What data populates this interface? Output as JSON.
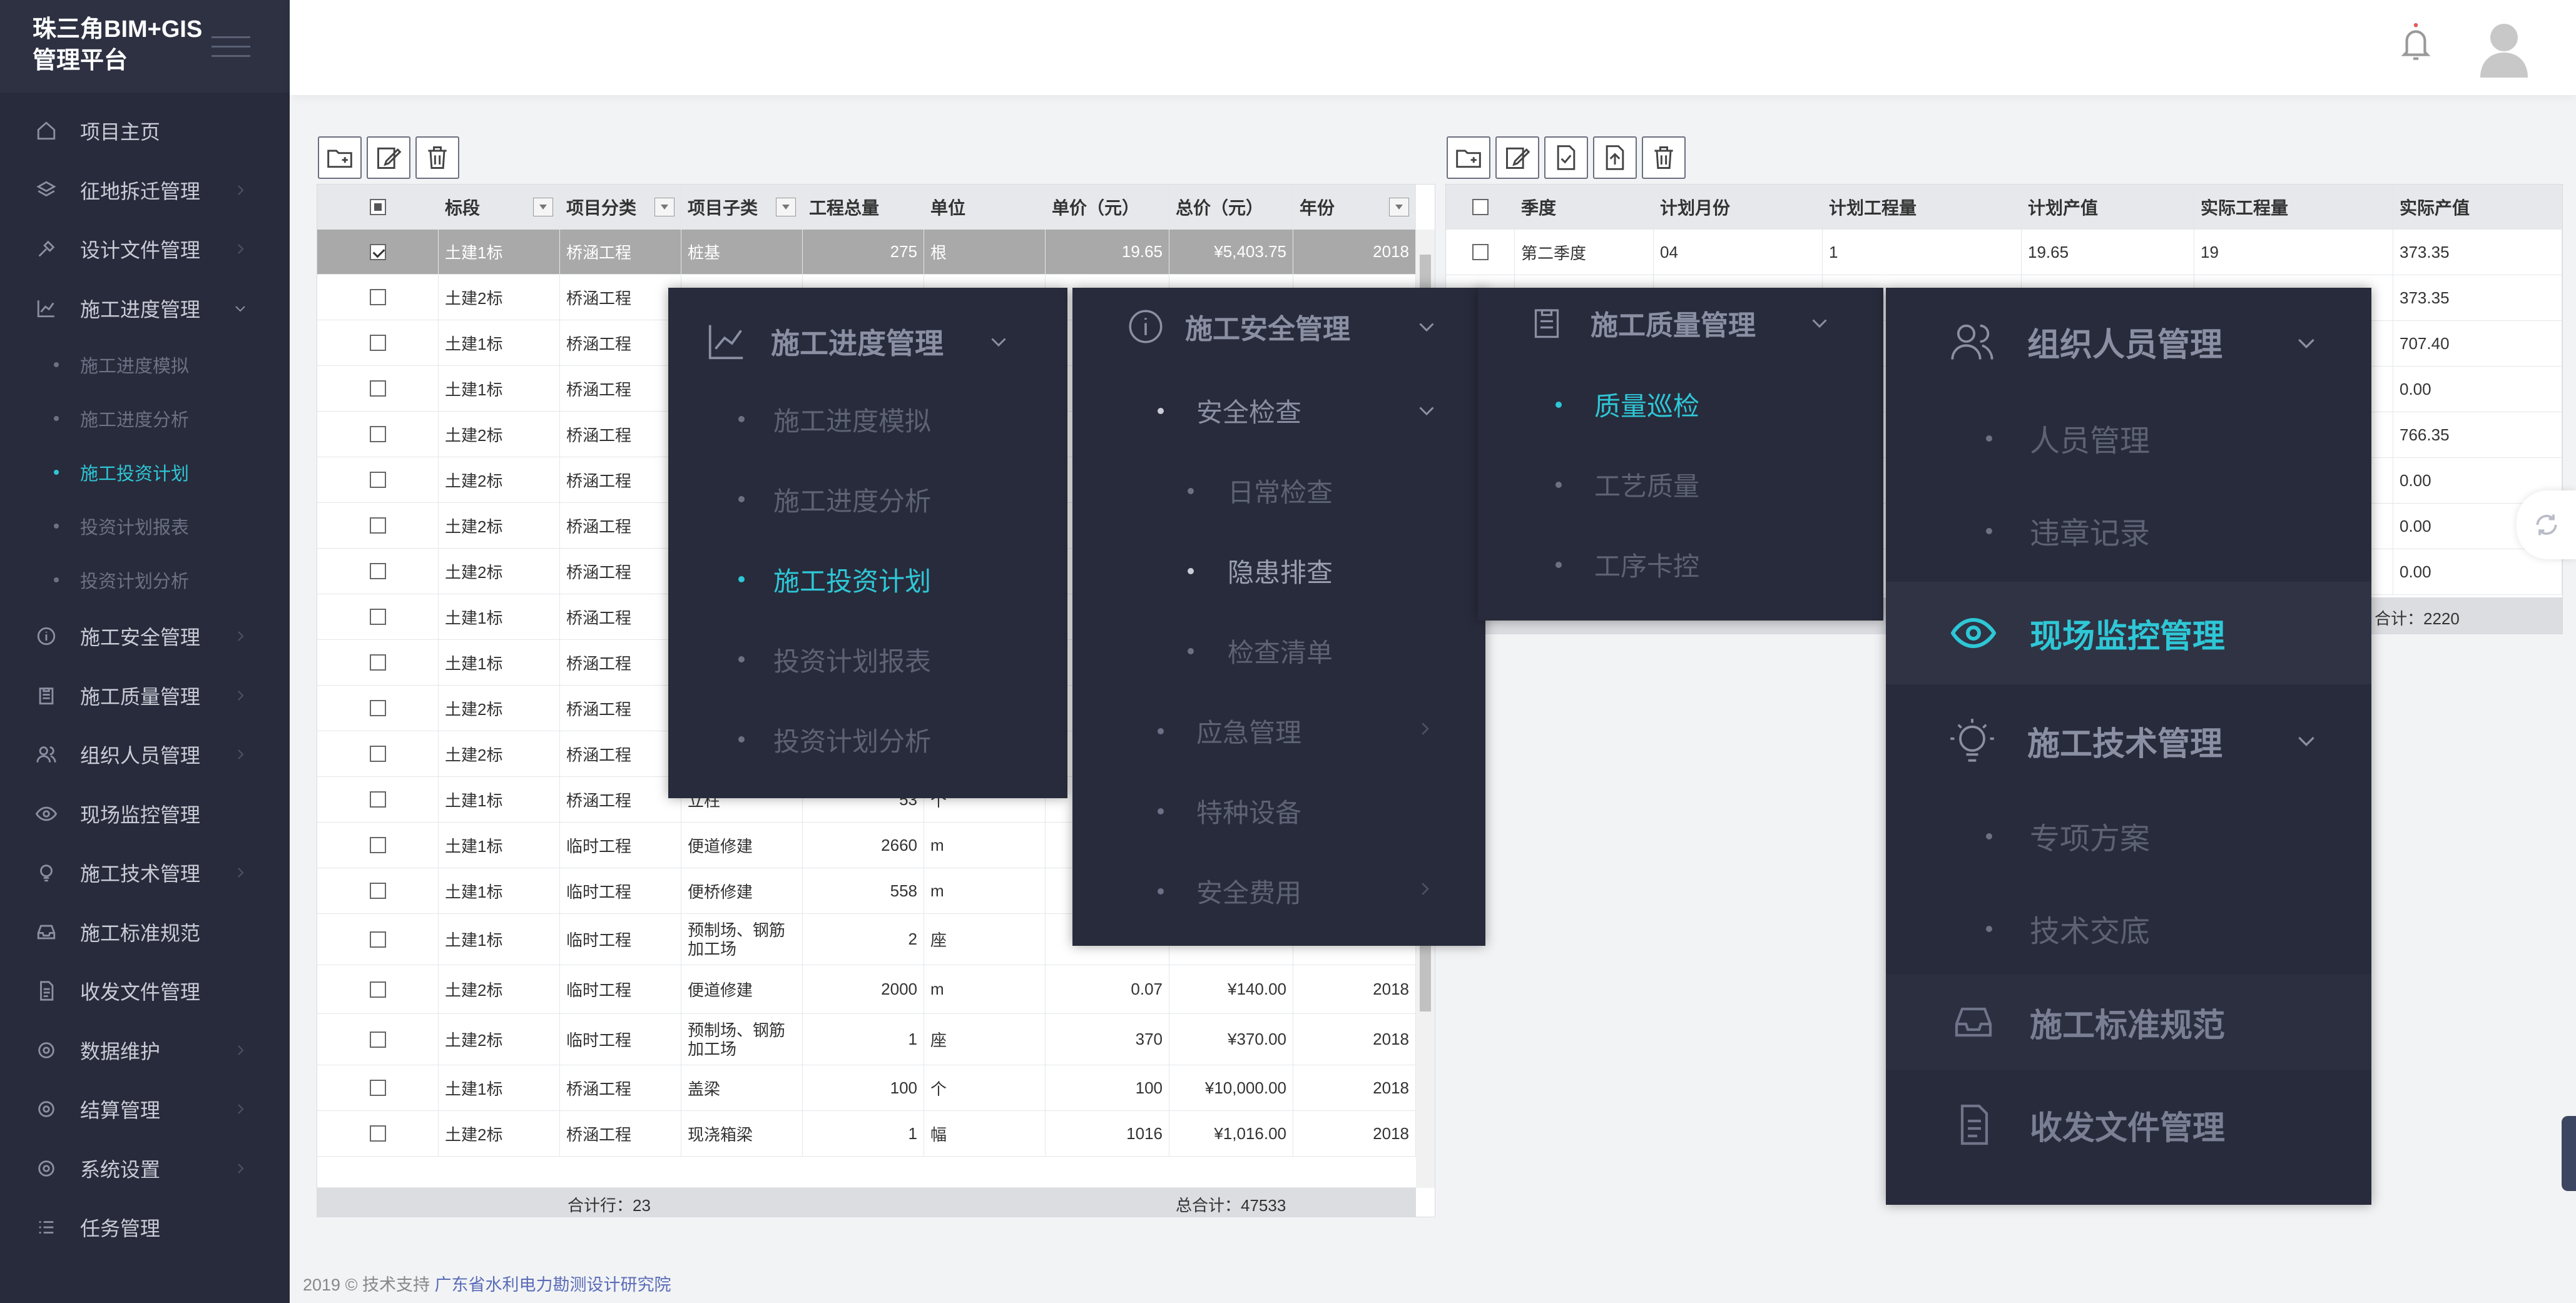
{
  "app": {
    "title": "珠三角BIM+GIS\n管理平台"
  },
  "sidebar": {
    "items": [
      {
        "label": "项目主页",
        "icon": "home-icon"
      },
      {
        "label": "征地拆迁管理",
        "icon": "layers-icon"
      },
      {
        "label": "设计文件管理",
        "icon": "tools-icon"
      },
      {
        "label": "施工进度管理",
        "icon": "chart-icon"
      },
      {
        "label": "施工安全管理",
        "icon": "info-icon"
      },
      {
        "label": "施工质量管理",
        "icon": "clipboard-icon"
      },
      {
        "label": "组织人员管理",
        "icon": "users-icon"
      },
      {
        "label": "现场监控管理",
        "icon": "eye-icon"
      },
      {
        "label": "施工技术管理",
        "icon": "bulb-icon"
      },
      {
        "label": "施工标准规范",
        "icon": "inbox-icon"
      },
      {
        "label": "收发文件管理",
        "icon": "document-icon"
      },
      {
        "label": "数据维护",
        "icon": "settings-icon"
      },
      {
        "label": "结算管理",
        "icon": "settings-icon"
      },
      {
        "label": "系统设置",
        "icon": "settings-icon"
      },
      {
        "label": "任务管理",
        "icon": "list-icon"
      }
    ],
    "progress_sub": [
      "施工进度模拟",
      "施工进度分析",
      "施工投资计划",
      "投资计划报表",
      "投资计划分析"
    ]
  },
  "left_table": {
    "headers": [
      "标段",
      "项目分类",
      "项目子类",
      "工程总量",
      "单位",
      "单价（元）",
      "总价（元）",
      "年份"
    ],
    "rows": [
      [
        "土建1标",
        "桥涵工程",
        "桩基",
        "275",
        "根",
        "19.65",
        "¥5,403.75",
        "2018"
      ],
      [
        "土建2标",
        "桥涵工程",
        "",
        "",
        "",
        "",
        "",
        ""
      ],
      [
        "土建1标",
        "桥涵工程",
        "",
        "",
        "",
        "",
        "",
        ""
      ],
      [
        "土建1标",
        "桥涵工程",
        "",
        "",
        "",
        "",
        "",
        ""
      ],
      [
        "土建2标",
        "桥涵工程",
        "",
        "",
        "",
        "",
        "",
        ""
      ],
      [
        "土建2标",
        "桥涵工程",
        "",
        "",
        "",
        "",
        "",
        ""
      ],
      [
        "土建2标",
        "桥涵工程",
        "",
        "",
        "",
        "",
        "",
        ""
      ],
      [
        "土建2标",
        "桥涵工程",
        "",
        "",
        "",
        "",
        "",
        ""
      ],
      [
        "土建1标",
        "桥涵工程",
        "",
        "",
        "",
        "",
        "",
        ""
      ],
      [
        "土建1标",
        "桥涵工程",
        "",
        "",
        "",
        "",
        "",
        ""
      ],
      [
        "土建2标",
        "桥涵工程",
        "",
        "",
        "",
        "",
        "",
        ""
      ],
      [
        "土建2标",
        "桥涵工程",
        "",
        "",
        "",
        "",
        "",
        ""
      ],
      [
        "土建1标",
        "桥涵工程",
        "立柱",
        "53",
        "个",
        "",
        "",
        ""
      ],
      [
        "土建1标",
        "临时工程",
        "便道修建",
        "2660",
        "m",
        "",
        "",
        ""
      ],
      [
        "土建1标",
        "临时工程",
        "便桥修建",
        "558",
        "m",
        "",
        "",
        ""
      ],
      [
        "土建1标",
        "临时工程",
        "预制场、钢筋加工场",
        "2",
        "座",
        "",
        "",
        ""
      ],
      [
        "土建2标",
        "临时工程",
        "便道修建",
        "2000",
        "m",
        "0.07",
        "¥140.00",
        "2018"
      ],
      [
        "土建2标",
        "临时工程",
        "预制场、钢筋加工场",
        "1",
        "座",
        "370",
        "¥370.00",
        "2018"
      ],
      [
        "土建1标",
        "桥涵工程",
        "盖梁",
        "100",
        "个",
        "100",
        "¥10,000.00",
        "2018"
      ],
      [
        "土建2标",
        "桥涵工程",
        "现浇箱梁",
        "1",
        "幅",
        "1016",
        "¥1,016.00",
        "2018"
      ]
    ],
    "footer_count": "合计行：23",
    "footer_total": "总合计：47533"
  },
  "right_table": {
    "headers": [
      "季度",
      "计划月份",
      "计划工程量",
      "计划产值",
      "实际工程量",
      "实际产值"
    ],
    "rows": [
      [
        "第二季度",
        "04",
        "1",
        "19.65",
        "19",
        "373.35"
      ],
      [
        "",
        "",
        "",
        "",
        "",
        "373.35"
      ],
      [
        "",
        "",
        "",
        "",
        "",
        "707.40"
      ],
      [
        "",
        "",
        "",
        "",
        "",
        "0.00"
      ],
      [
        "",
        "",
        "",
        "",
        "",
        "766.35"
      ],
      [
        "",
        "",
        "",
        "",
        "",
        "0.00"
      ],
      [
        "",
        "",
        "",
        "",
        "",
        "0.00"
      ],
      [
        "",
        "",
        "",
        "",
        "",
        "0.00"
      ]
    ],
    "footer_total": "合计：2220"
  },
  "popup_progress": {
    "title": "施工进度管理",
    "items": [
      "施工进度模拟",
      "施工进度分析",
      "施工投资计划",
      "投资计划报表",
      "投资计划分析"
    ]
  },
  "popup_safety": {
    "title": "施工安全管理",
    "group": "安全检查",
    "sub": [
      "日常检查",
      "隐患排查",
      "检查清单"
    ],
    "items": [
      "应急管理",
      "特种设备",
      "安全费用"
    ]
  },
  "popup_quality": {
    "title": "施工质量管理",
    "items": [
      "质量巡检",
      "工艺质量",
      "工序卡控"
    ]
  },
  "popup_org": {
    "title": "组织人员管理",
    "items": [
      "人员管理",
      "违章记录"
    ],
    "monitor": "现场监控管理",
    "tech": "施工技术管理",
    "tech_items": [
      "专项方案",
      "技术交底"
    ],
    "standard": "施工标准规范",
    "docs": "收发文件管理"
  },
  "footer": {
    "copyright": "2019 © 技术支持 ",
    "org": "广东省水利电力勘测设计研究院"
  },
  "colors": {
    "sidebar": "#282b3b",
    "accent": "#2ec7d6",
    "selected_row": "#a9a9a9"
  }
}
